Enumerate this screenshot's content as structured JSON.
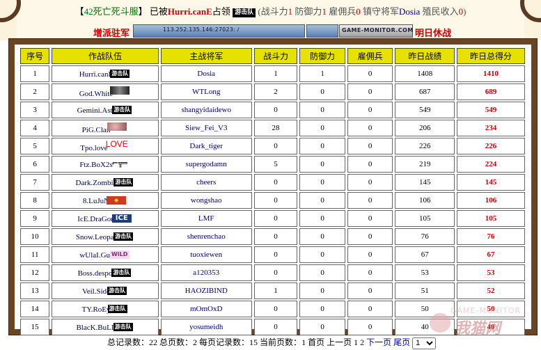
{
  "status": {
    "bracket_open": "【",
    "server": "42死亡死斗服",
    "bracket_close": "】",
    "occupied_by": "已被",
    "team": "Hurri.canE",
    "occupy_text": "占领",
    "team_badge": "游击队",
    "stats_prefix": "(战斗力",
    "power": "1",
    "defense_label": " 防御力",
    "defense": "1",
    "merc_label": " 雇佣兵",
    "merc": "0",
    "general_label": " 镇守将军",
    "general": "Dosia",
    "income_label": " 殖民收入",
    "income": "0",
    "stats_suffix": ")"
  },
  "header_links": {
    "left": "增派驻军",
    "right": "明日休战",
    "ip_banner": "113.252.135.146:27023:  /",
    "gm_banner": "GAME-MONITOR.COM"
  },
  "table": {
    "headers": [
      "序号",
      "作战队伍",
      "主战将军",
      "战斗力",
      "防御力",
      "雇佣兵",
      "昨日战绩",
      "昨日总得分"
    ],
    "rows": [
      {
        "no": "1",
        "team": "Hurri.canE",
        "icon": "游击队",
        "icon_type": "badge",
        "general": "Dosia",
        "power": "1",
        "defense": "1",
        "merc": "0",
        "record": "1408",
        "score": "1410"
      },
      {
        "no": "2",
        "team": "God.White",
        "icon": "",
        "icon_type": "img",
        "general": "WTLong",
        "power": "2",
        "defense": "0",
        "merc": "0",
        "record": "687",
        "score": "689"
      },
      {
        "no": "3",
        "team": "Gemini.Astr",
        "icon": "游击队",
        "icon_type": "badge",
        "general": "shangyidaidewo",
        "power": "0",
        "defense": "0",
        "merc": "0",
        "record": "549",
        "score": "549"
      },
      {
        "no": "4",
        "team": "PiG.Clan",
        "icon": "",
        "icon_type": "pig",
        "general": "Siew_Fei_V3",
        "power": "28",
        "defense": "0",
        "merc": "0",
        "record": "206",
        "score": "234"
      },
      {
        "no": "5",
        "team": "Tpo.love",
        "icon": "LOVE",
        "icon_type": "love",
        "general": "Dark_tiger",
        "power": "0",
        "defense": "0",
        "merc": "0",
        "record": "226",
        "score": "226"
      },
      {
        "no": "6",
        "team": "Ftz.BoX2s",
        "icon": "⌐╦═",
        "icon_type": "gun",
        "general": "supergodamn",
        "power": "5",
        "defense": "0",
        "merc": "0",
        "record": "219",
        "score": "224"
      },
      {
        "no": "7",
        "team": "Dark.Zombie",
        "icon": "游击队",
        "icon_type": "badge",
        "general": "cheers",
        "power": "0",
        "defense": "0",
        "merc": "0",
        "record": "145",
        "score": "145"
      },
      {
        "no": "8",
        "team": "8.LuJuN",
        "icon": "◆",
        "icon_type": "red",
        "general": "wongshao",
        "power": "0",
        "defense": "0",
        "merc": "0",
        "record": "106",
        "score": "106"
      },
      {
        "no": "9",
        "team": "IcE.DraGon",
        "icon": "ICE",
        "icon_type": "ice",
        "general": "LMF",
        "power": "0",
        "defense": "0",
        "merc": "0",
        "record": "105",
        "score": "105"
      },
      {
        "no": "10",
        "team": "Snow.Leopar",
        "icon": "游击队",
        "icon_type": "badge",
        "general": "shenrenchao",
        "power": "0",
        "defense": "0",
        "merc": "0",
        "record": "76",
        "score": "76"
      },
      {
        "no": "11",
        "team": "wUlaI.GuI",
        "icon": "WiLD",
        "icon_type": "wild",
        "general": "tuoxiewen",
        "power": "0",
        "defense": "0",
        "merc": "0",
        "record": "67",
        "score": "67"
      },
      {
        "no": "12",
        "team": "Boss.despot",
        "icon": "游击队",
        "icon_type": "badge",
        "general": "a120353",
        "power": "0",
        "defense": "0",
        "merc": "0",
        "record": "53",
        "score": "53"
      },
      {
        "no": "13",
        "team": "Veil.Side",
        "icon": "游击队",
        "icon_type": "badge",
        "general": "HAOZIBIND",
        "power": "1",
        "defense": "0",
        "merc": "0",
        "record": "51",
        "score": "52"
      },
      {
        "no": "14",
        "team": "TY.RoEy",
        "icon": "游击队",
        "icon_type": "badge",
        "general": "mOmOxD",
        "power": "0",
        "defense": "0",
        "merc": "0",
        "record": "50",
        "score": "50"
      },
      {
        "no": "15",
        "team": "BlacK.BuLL",
        "icon": "游击队",
        "icon_type": "badge",
        "general": "yosumeidh",
        "power": "0",
        "defense": "0",
        "merc": "0",
        "record": "40",
        "score": "40"
      }
    ]
  },
  "footer": {
    "total_label": "总记录数：",
    "total": "22",
    "pages_label": " 总页数：",
    "pages": "2",
    "per_page_label": " 每页记录数：",
    "per_page": "15",
    "current_label": " 当前页数：",
    "current": "1",
    "first": "首页",
    "prev": "上一页",
    "page1": "1",
    "page2": "2",
    "next": "下一页",
    "last": "尾页",
    "select_value": "1"
  },
  "watermark": {
    "line1": "GAME-MONITOR",
    "line2": "我猫网"
  }
}
